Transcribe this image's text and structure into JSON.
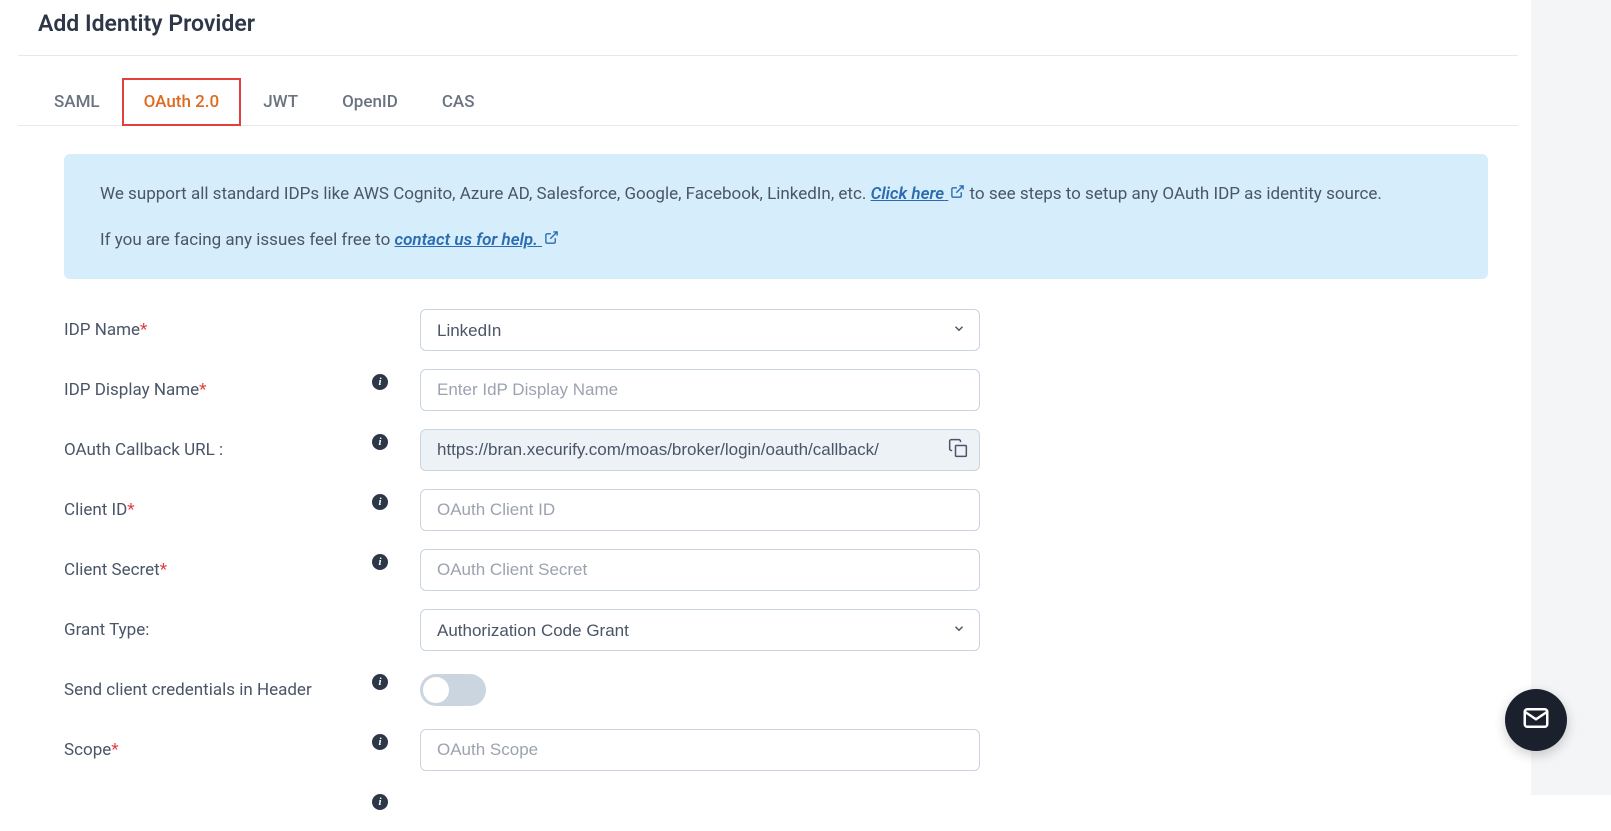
{
  "page": {
    "title": "Add Identity Provider"
  },
  "tabs": {
    "saml": "SAML",
    "oauth": "OAuth 2.0",
    "jwt": "JWT",
    "openid": "OpenID",
    "cas": "CAS"
  },
  "info": {
    "line1_pre": "We support all standard IDPs like AWS Cognito, Azure AD, Salesforce, Google, Facebook, LinkedIn, etc. ",
    "click_here": "Click here",
    "line1_post": " to see steps to setup any OAuth IDP as identity source.",
    "line2_pre": "If you are facing any issues feel free to ",
    "contact_us": "contact us for help."
  },
  "form": {
    "idp_name": {
      "label": "IDP Name",
      "value": "LinkedIn"
    },
    "idp_display_name": {
      "label": "IDP Display Name",
      "placeholder": "Enter IdP Display Name",
      "value": ""
    },
    "callback_url": {
      "label": "OAuth Callback URL :",
      "value": "https://bran.xecurify.com/moas/broker/login/oauth/callback/"
    },
    "client_id": {
      "label": "Client ID",
      "placeholder": "OAuth Client ID",
      "value": ""
    },
    "client_secret": {
      "label": "Client Secret",
      "placeholder": "OAuth Client Secret",
      "value": ""
    },
    "grant_type": {
      "label": "Grant Type:",
      "value": "Authorization Code Grant"
    },
    "send_in_header": {
      "label": "Send client credentials in Header",
      "value": false
    },
    "scope": {
      "label": "Scope",
      "placeholder": "OAuth Scope",
      "value": ""
    }
  }
}
